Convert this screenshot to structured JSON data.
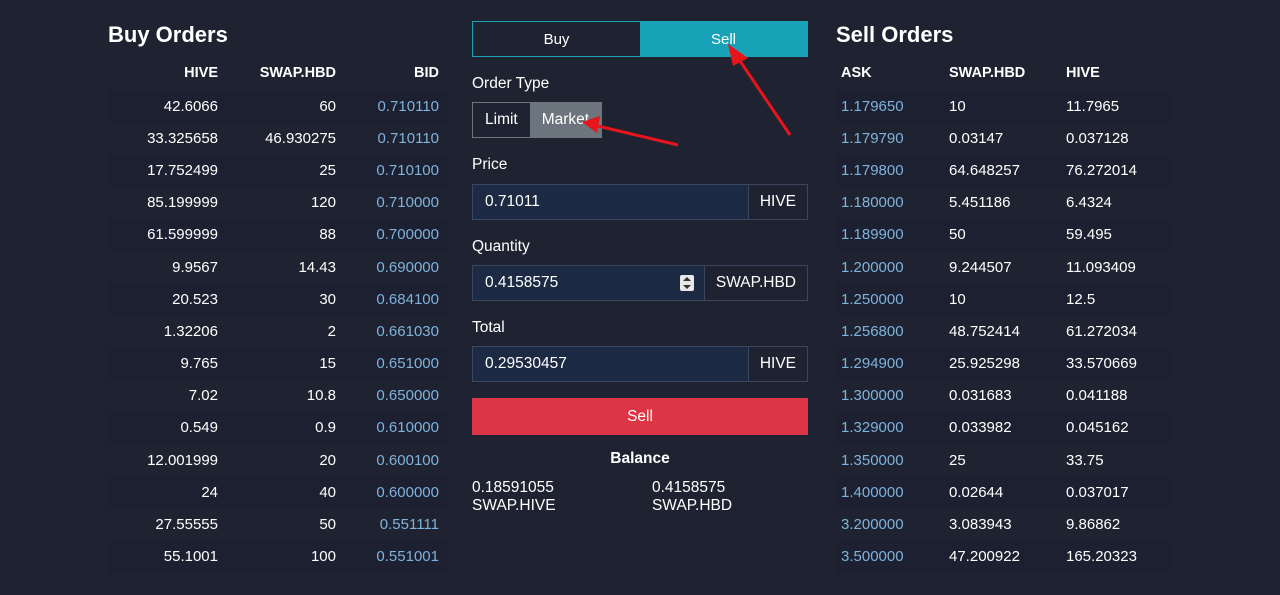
{
  "buy_orders": {
    "title": "Buy Orders",
    "headers": [
      "HIVE",
      "SWAP.HBD",
      "BID"
    ],
    "rows": [
      [
        "42.6066",
        "60",
        "0.710110"
      ],
      [
        "33.325658",
        "46.930275",
        "0.710110"
      ],
      [
        "17.752499",
        "25",
        "0.710100"
      ],
      [
        "85.199999",
        "120",
        "0.710000"
      ],
      [
        "61.599999",
        "88",
        "0.700000"
      ],
      [
        "9.9567",
        "14.43",
        "0.690000"
      ],
      [
        "20.523",
        "30",
        "0.684100"
      ],
      [
        "1.32206",
        "2",
        "0.661030"
      ],
      [
        "9.765",
        "15",
        "0.651000"
      ],
      [
        "7.02",
        "10.8",
        "0.650000"
      ],
      [
        "0.549",
        "0.9",
        "0.610000"
      ],
      [
        "12.001999",
        "20",
        "0.600100"
      ],
      [
        "24",
        "40",
        "0.600000"
      ],
      [
        "27.55555",
        "50",
        "0.551111"
      ],
      [
        "55.1001",
        "100",
        "0.551001"
      ]
    ]
  },
  "sell_orders": {
    "title": "Sell Orders",
    "headers": [
      "ASK",
      "SWAP.HBD",
      "HIVE"
    ],
    "rows": [
      [
        "1.179650",
        "10",
        "11.7965"
      ],
      [
        "1.179790",
        "0.03147",
        "0.037128"
      ],
      [
        "1.179800",
        "64.648257",
        "76.272014"
      ],
      [
        "1.180000",
        "5.451186",
        "6.4324"
      ],
      [
        "1.189900",
        "50",
        "59.495"
      ],
      [
        "1.200000",
        "9.244507",
        "11.093409"
      ],
      [
        "1.250000",
        "10",
        "12.5"
      ],
      [
        "1.256800",
        "48.752414",
        "61.272034"
      ],
      [
        "1.294900",
        "25.925298",
        "33.570669"
      ],
      [
        "1.300000",
        "0.031683",
        "0.041188"
      ],
      [
        "1.329000",
        "0.033982",
        "0.045162"
      ],
      [
        "1.350000",
        "25",
        "33.75"
      ],
      [
        "1.400000",
        "0.02644",
        "0.037017"
      ],
      [
        "3.200000",
        "3.083943",
        "9.86862"
      ],
      [
        "3.500000",
        "47.200922",
        "165.20323"
      ]
    ]
  },
  "form": {
    "tab_buy": "Buy",
    "tab_sell": "Sell",
    "active_tab": "Sell",
    "order_type_label": "Order Type",
    "order_type_limit": "Limit",
    "order_type_market": "Market",
    "active_order_type": "Market",
    "price_label": "Price",
    "price_value": "0.71011",
    "price_unit": "HIVE",
    "quantity_label": "Quantity",
    "quantity_value": "0.4158575",
    "quantity_unit": "SWAP.HBD",
    "total_label": "Total",
    "total_value": "0.29530457",
    "total_unit": "HIVE",
    "submit_label": "Sell",
    "balance_title": "Balance",
    "balance_hive": "0.18591055 SWAP.HIVE",
    "balance_hbd": "0.4158575 SWAP.HBD"
  },
  "colors": {
    "background": "#1f2331",
    "accent": "#17a2b8",
    "danger": "#dc3545",
    "price_text": "#7fb3dc",
    "annotation_arrow": "#e8141c"
  }
}
